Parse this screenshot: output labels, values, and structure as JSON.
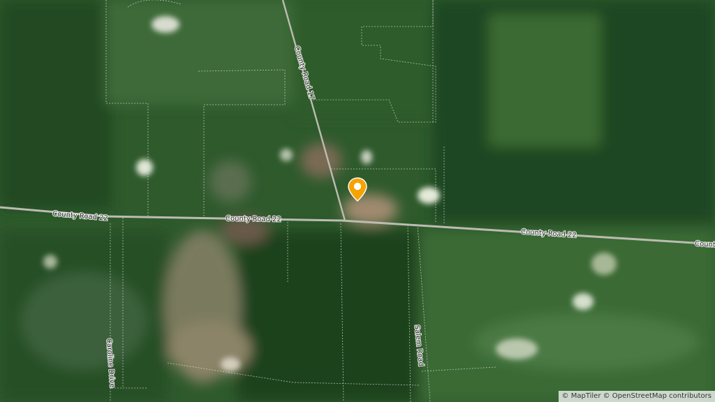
{
  "map": {
    "imagery": "satellite",
    "roads": {
      "county_road_22": "County Road 22",
      "county_road_22_clipped": "Count",
      "county_road_17": "County Road 17",
      "salem_road": "Salem Road",
      "caroline_drive": "Caroline Drive"
    },
    "marker": {
      "icon": "map-pin-icon",
      "color": "#f5a300"
    },
    "attribution": "© MapTiler © OpenStreetMap contributors"
  }
}
